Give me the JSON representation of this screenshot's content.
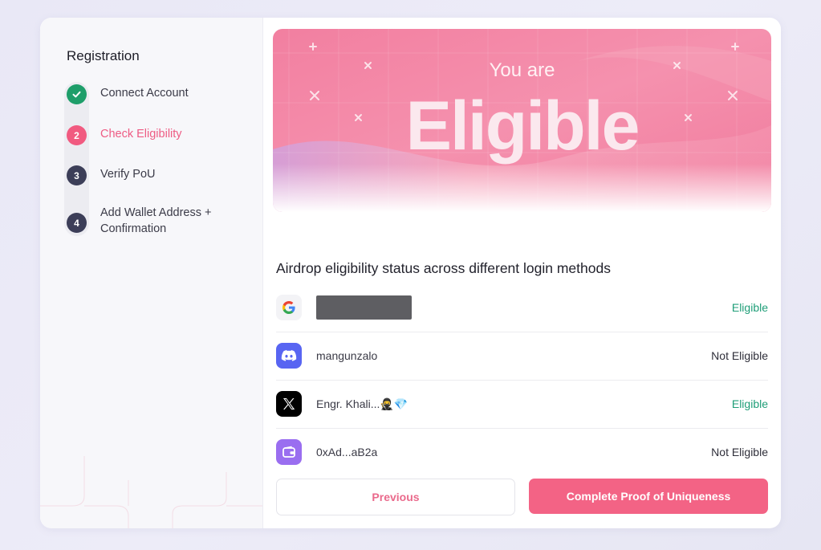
{
  "sidebar": {
    "title": "Registration",
    "steps": [
      {
        "number": "",
        "label": "Connect Account",
        "state": "done"
      },
      {
        "number": "2",
        "label": "Check Eligibility",
        "state": "active"
      },
      {
        "number": "3",
        "label": "Verify PoU",
        "state": "todo"
      },
      {
        "number": "4",
        "label": "Add Wallet Address +",
        "label2": "Confirmation",
        "state": "todo"
      }
    ]
  },
  "hero": {
    "subtitle": "You are",
    "headline": "Eligible"
  },
  "eligibility": {
    "title": "Airdrop eligibility status across different login methods",
    "rows": [
      {
        "method": "google",
        "icon": "google-icon",
        "name": "",
        "status": "Eligible"
      },
      {
        "method": "discord",
        "icon": "discord-icon",
        "name": "mangunzalo",
        "status": "Not Eligible"
      },
      {
        "method": "x",
        "icon": "x-icon",
        "name": "Engr. Khali...🥷💎",
        "status": "Eligible"
      },
      {
        "method": "wallet",
        "icon": "wallet-icon",
        "name": "0xAd...aB2a",
        "status": "Not Eligible"
      }
    ]
  },
  "buttons": {
    "previous": "Previous",
    "next": "Complete Proof of Uniqueness"
  },
  "colors": {
    "accent": "#f36385",
    "eligible": "#1f9e78",
    "done": "#1e9e6a",
    "discord": "#5865f2",
    "wallet": "#9a6ef0"
  }
}
